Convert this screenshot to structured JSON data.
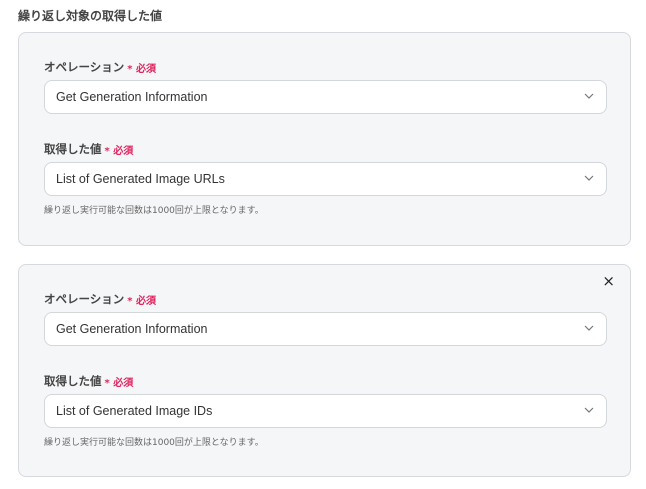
{
  "section_title": "繰り返し対象の取得した値",
  "required_label": "必須",
  "required_mark": "*",
  "hint": "繰り返し実行可能な回数は1000回が上限となります。",
  "cards": [
    {
      "operation_label": "オペレーション",
      "operation_value": "Get Generation Information",
      "value_label": "取得した値",
      "value_value": "List of Generated Image URLs"
    },
    {
      "operation_label": "オペレーション",
      "operation_value": "Get Generation Information",
      "value_label": "取得した値",
      "value_value": "List of Generated Image IDs",
      "close_icon": "×"
    }
  ]
}
